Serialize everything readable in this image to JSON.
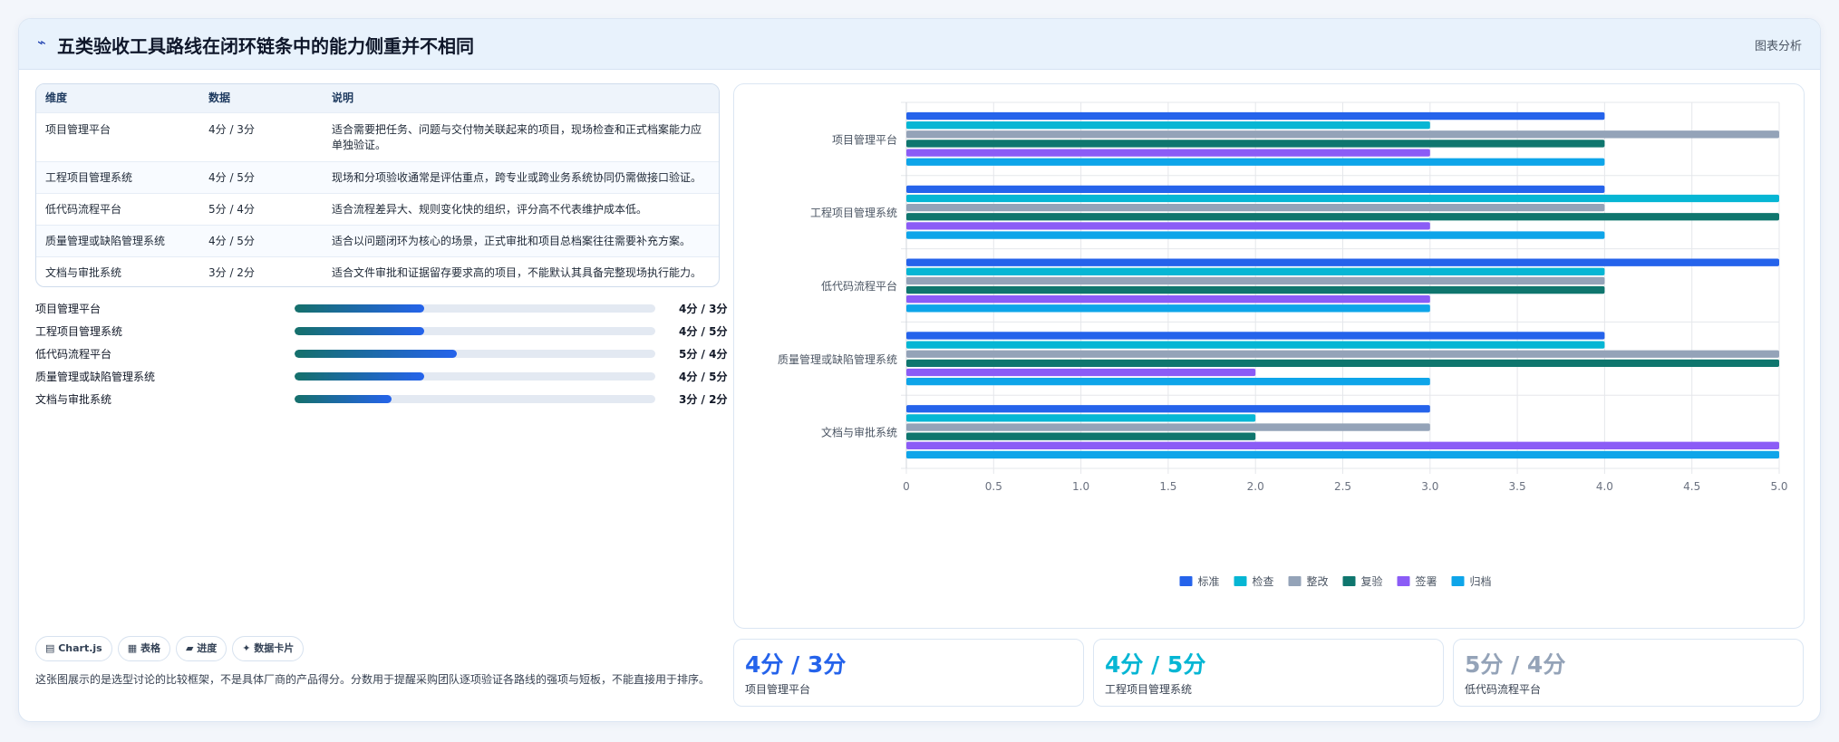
{
  "header": {
    "icon": "spark-icon",
    "title": "五类验收工具路线在闭环链条中的能力侧重并不相同",
    "tag": "图表分析"
  },
  "table": {
    "columns": [
      "维度",
      "数据",
      "说明"
    ],
    "rows": [
      {
        "name": "项目管理平台",
        "score": "4分 / 3分",
        "desc": "适合需要把任务、问题与交付物关联起来的项目，现场检查和正式档案能力应单独验证。"
      },
      {
        "name": "工程项目管理系统",
        "score": "4分 / 5分",
        "desc": "现场和分项验收通常是评估重点，跨专业或跨业务系统协同仍需做接口验证。"
      },
      {
        "name": "低代码流程平台",
        "score": "5分 / 4分",
        "desc": "适合流程差异大、规则变化快的组织，评分高不代表维护成本低。"
      },
      {
        "name": "质量管理或缺陷管理系统",
        "score": "4分 / 5分",
        "desc": "适合以问题闭环为核心的场景，正式审批和项目总档案往往需要补充方案。"
      },
      {
        "name": "文档与审批系统",
        "score": "3分 / 2分",
        "desc": "适合文件审批和证据留存要求高的项目，不能默认其具备完整现场执行能力。"
      }
    ]
  },
  "progress": [
    {
      "label": "项目管理平台",
      "value": "4分 / 3分",
      "fraction": 0.36
    },
    {
      "label": "工程项目管理系统",
      "value": "4分 / 5分",
      "fraction": 0.36
    },
    {
      "label": "低代码流程平台",
      "value": "5分 / 4分",
      "fraction": 0.45
    },
    {
      "label": "质量管理或缺陷管理系统",
      "value": "4分 / 5分",
      "fraction": 0.36
    },
    {
      "label": "文档与审批系统",
      "value": "3分 / 2分",
      "fraction": 0.27
    }
  ],
  "chips": [
    "▤ Chart.js",
    "▦ 表格",
    "▰ 进度",
    "✦ 数据卡片"
  ],
  "note": "这张图展示的是选型讨论的比较框架，不是具体厂商的产品得分。分数用于提醒采购团队逐项验证各路线的强项与短板，不能直接用于排序。",
  "stats": [
    {
      "value": "4分 / 3分",
      "label": "项目管理平台",
      "color": "#2563eb"
    },
    {
      "value": "4分 / 5分",
      "label": "工程项目管理系统",
      "color": "#06b6d4"
    },
    {
      "value": "5分 / 4分",
      "label": "低代码流程平台",
      "color": "#94a3b8"
    }
  ],
  "chart_data": {
    "type": "bar",
    "orientation": "horizontal",
    "categories": [
      "项目管理平台",
      "工程项目管理系统",
      "低代码流程平台",
      "质量管理或缺陷管理系统",
      "文档与审批系统"
    ],
    "series": [
      {
        "name": "标准",
        "color": "#2563eb",
        "values": [
          4,
          4,
          5,
          4,
          3
        ]
      },
      {
        "name": "检查",
        "color": "#06b6d4",
        "values": [
          3,
          5,
          4,
          4,
          2
        ]
      },
      {
        "name": "整改",
        "color": "#94a3b8",
        "values": [
          5,
          4,
          4,
          5,
          3
        ]
      },
      {
        "name": "复验",
        "color": "#0f766e",
        "values": [
          4,
          5,
          4,
          5,
          2
        ]
      },
      {
        "name": "签署",
        "color": "#8b5cf6",
        "values": [
          3,
          3,
          3,
          2,
          5
        ]
      },
      {
        "name": "归档",
        "color": "#0ea5e9",
        "values": [
          4,
          4,
          3,
          3,
          5
        ]
      }
    ],
    "xlim": [
      0,
      5
    ],
    "xticks": [
      "0",
      "0.5",
      "1.0",
      "1.5",
      "2.0",
      "2.5",
      "3.0",
      "3.5",
      "4.0",
      "4.5",
      "5.0"
    ],
    "grid": true,
    "legend": "bottom"
  }
}
